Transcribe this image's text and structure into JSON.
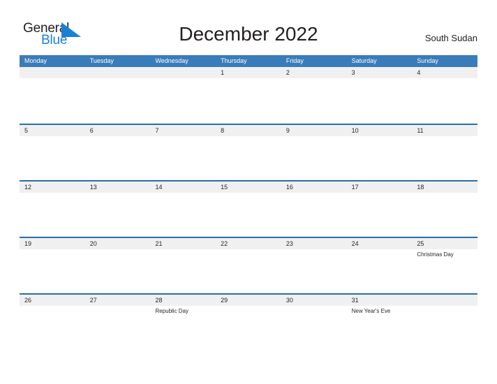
{
  "brand": {
    "name_part1": "General",
    "name_part2": "Blue",
    "triangle_icon": "blue-triangle-icon",
    "color_dark": "#231f20",
    "color_blue": "#1b7fd4"
  },
  "header": {
    "title": "December 2022",
    "country": "South Sudan"
  },
  "theme": {
    "header_blue": "#3a7cb9",
    "row_border_blue": "#2c6ea8",
    "date_band_gray": "#f0f0f0",
    "text_dark": "#262626",
    "page_background": "#ffffff"
  },
  "calendar": {
    "weekdays": [
      "Monday",
      "Tuesday",
      "Wednesday",
      "Thursday",
      "Friday",
      "Saturday",
      "Sunday"
    ],
    "weeks": [
      [
        {
          "date": "",
          "events": []
        },
        {
          "date": "",
          "events": []
        },
        {
          "date": "",
          "events": []
        },
        {
          "date": "1",
          "events": []
        },
        {
          "date": "2",
          "events": []
        },
        {
          "date": "3",
          "events": []
        },
        {
          "date": "4",
          "events": []
        }
      ],
      [
        {
          "date": "5",
          "events": []
        },
        {
          "date": "6",
          "events": []
        },
        {
          "date": "7",
          "events": []
        },
        {
          "date": "8",
          "events": []
        },
        {
          "date": "9",
          "events": []
        },
        {
          "date": "10",
          "events": []
        },
        {
          "date": "11",
          "events": []
        }
      ],
      [
        {
          "date": "12",
          "events": []
        },
        {
          "date": "13",
          "events": []
        },
        {
          "date": "14",
          "events": []
        },
        {
          "date": "15",
          "events": []
        },
        {
          "date": "16",
          "events": []
        },
        {
          "date": "17",
          "events": []
        },
        {
          "date": "18",
          "events": []
        }
      ],
      [
        {
          "date": "19",
          "events": []
        },
        {
          "date": "20",
          "events": []
        },
        {
          "date": "21",
          "events": []
        },
        {
          "date": "22",
          "events": []
        },
        {
          "date": "23",
          "events": []
        },
        {
          "date": "24",
          "events": []
        },
        {
          "date": "25",
          "events": [
            "Christmas Day"
          ]
        }
      ],
      [
        {
          "date": "26",
          "events": []
        },
        {
          "date": "27",
          "events": []
        },
        {
          "date": "28",
          "events": [
            "Republic Day"
          ]
        },
        {
          "date": "29",
          "events": []
        },
        {
          "date": "30",
          "events": []
        },
        {
          "date": "31",
          "events": [
            "New Year's Eve"
          ]
        },
        {
          "date": "",
          "events": []
        }
      ]
    ]
  }
}
